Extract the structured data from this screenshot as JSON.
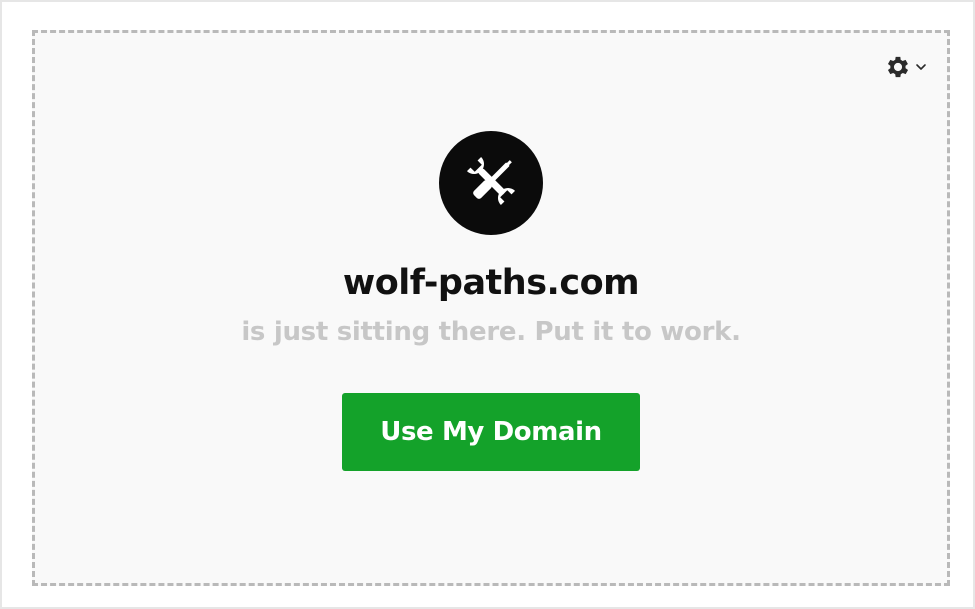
{
  "page": {
    "domain_name": "wolf-paths.com",
    "tagline": "is just sitting there. Put it to work.",
    "cta_label": "Use My Domain"
  },
  "icons": {
    "logo": "tools-icon",
    "settings": "gear-icon",
    "settings_dropdown": "chevron-down-icon"
  },
  "colors": {
    "accent": "#14a22a",
    "logo_background": "#0b0b0b",
    "domain_text": "#111111",
    "tagline_text": "#c7c7c7",
    "card_background": "#f9f9f9",
    "card_border": "#b9b9b9"
  }
}
